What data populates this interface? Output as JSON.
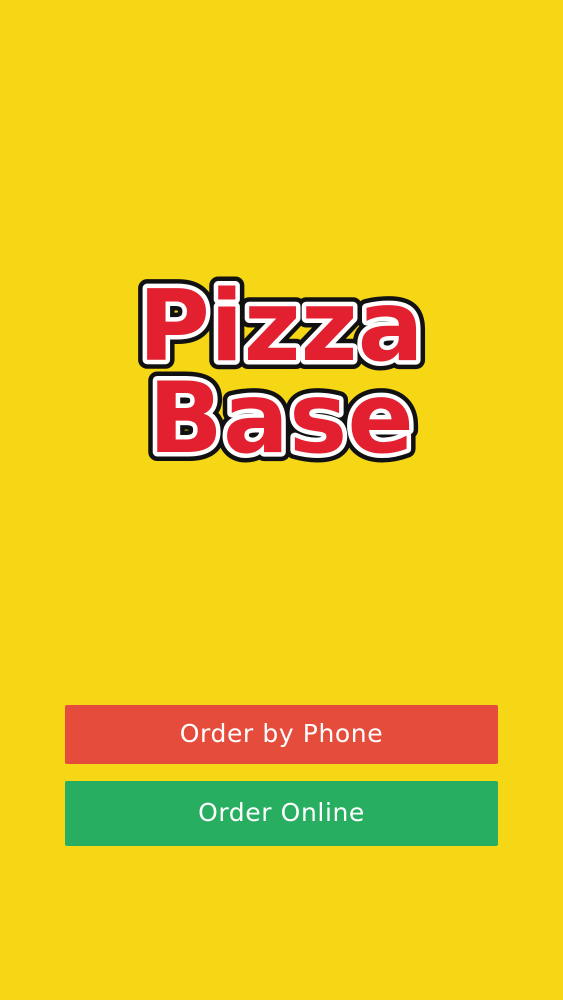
{
  "app": {
    "background_color": "#f6d716"
  },
  "logo": {
    "line1": "Pizza",
    "line2": "Base",
    "fill_color": "#e32030",
    "inner_outline_color": "#ffffff",
    "outer_outline_color": "#111111"
  },
  "buttons": {
    "order_phone": {
      "label": "Order by Phone",
      "color": "#e64c3c"
    },
    "order_online": {
      "label": "Order Online",
      "color": "#27ae60"
    }
  }
}
